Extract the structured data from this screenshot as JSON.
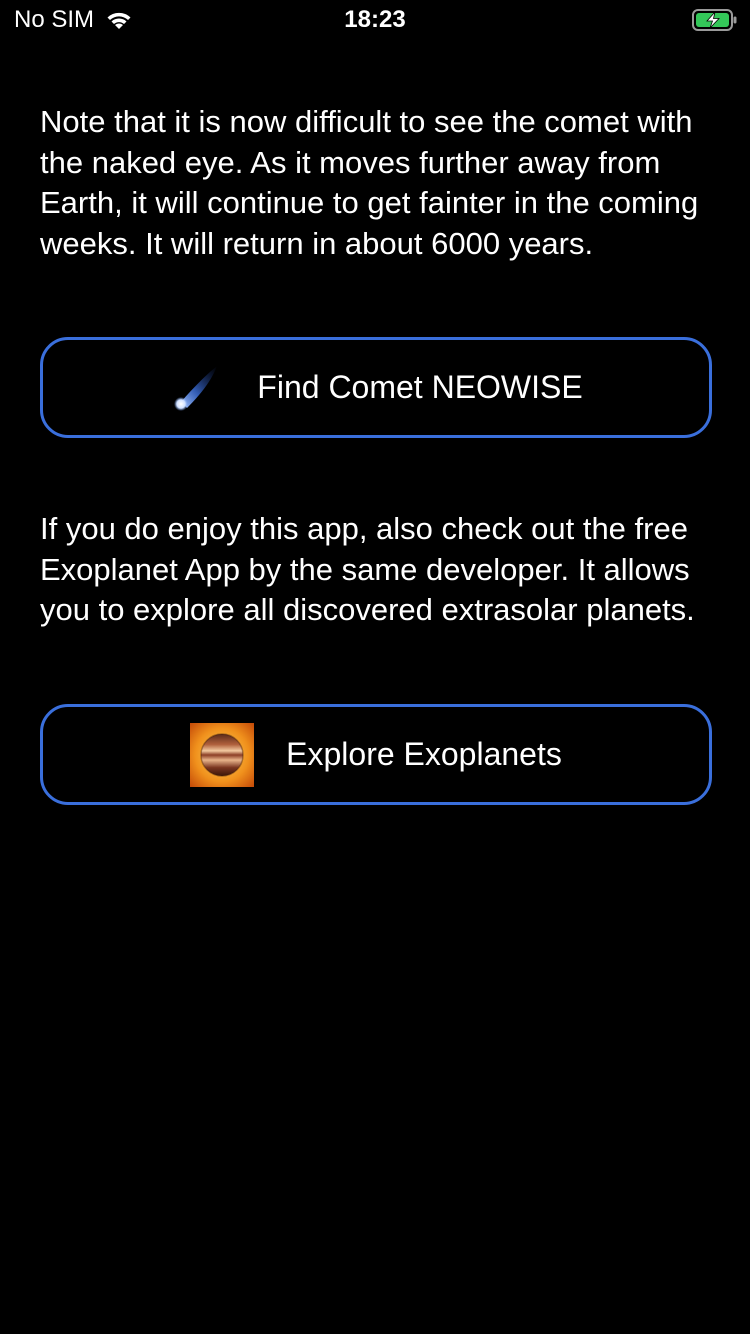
{
  "status_bar": {
    "carrier": "No SIM",
    "time": "18:23",
    "wifi_icon": "wifi-icon",
    "battery_icon": "battery-charging-icon",
    "battery_color": "#34c759"
  },
  "main": {
    "paragraph_1": "Note that it is now difficult to see the comet with the naked eye. As it moves further away from Earth, it will continue to get fainter in the coming weeks. It will return in about 6000 years.",
    "comet_button": {
      "label": "Find Comet NEOWISE",
      "icon": "comet-icon"
    },
    "paragraph_2": "If you do enjoy this app, also check out the free Exoplanet App by the same developer. It allows you to explore all discovered extrasolar planets.",
    "exoplanet_button": {
      "label": "Explore Exoplanets",
      "icon": "exoplanet-app-icon"
    }
  },
  "colors": {
    "background": "#000000",
    "text": "#ffffff",
    "button_border": "#3a6fdc"
  }
}
